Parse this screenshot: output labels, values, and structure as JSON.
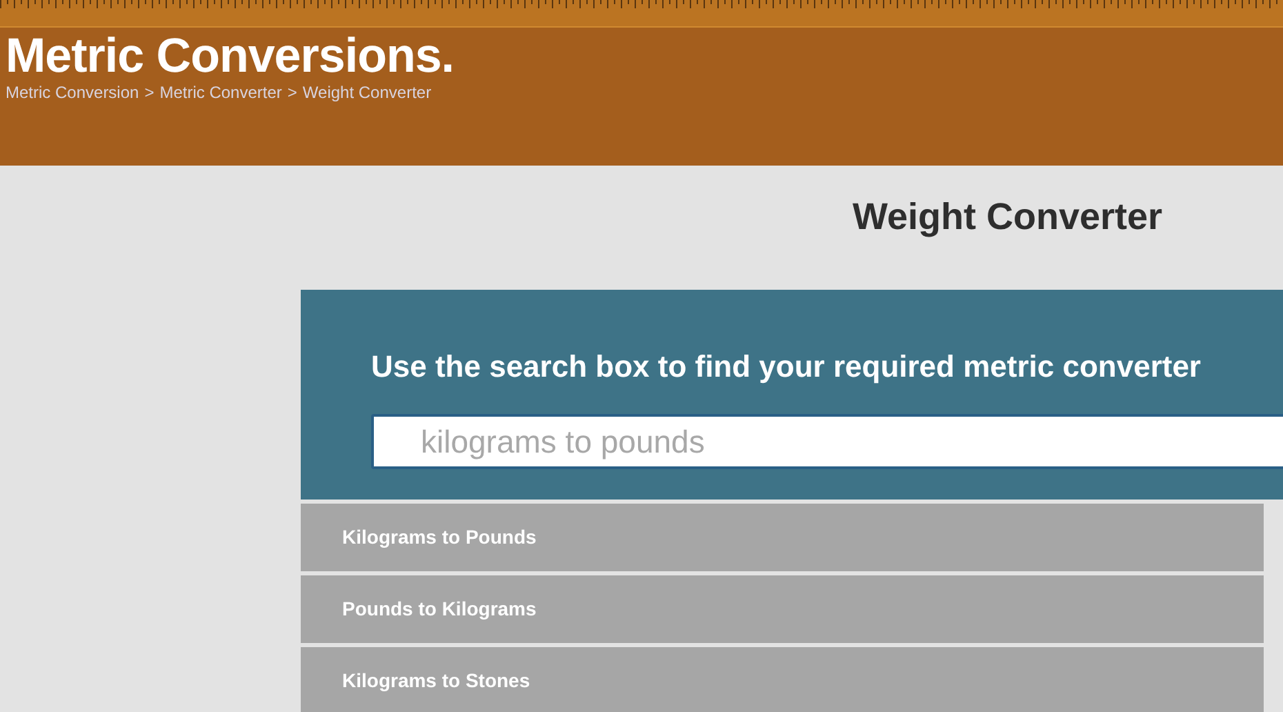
{
  "header": {
    "logo": "Metric Conversions.",
    "breadcrumb": [
      "Metric Conversion",
      "Metric Converter",
      "Weight Converter"
    ],
    "separator": ">"
  },
  "page_title": "Weight Converter",
  "search_panel": {
    "heading": "Use the search box to find your required metric converter",
    "placeholder": "kilograms to pounds"
  },
  "results": [
    {
      "label": "Kilograms to Pounds"
    },
    {
      "label": "Pounds to Kilograms"
    },
    {
      "label": "Kilograms to Stones"
    }
  ]
}
